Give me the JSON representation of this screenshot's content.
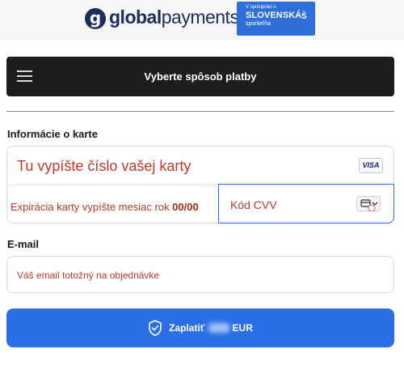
{
  "header": {
    "logo_mark": "g",
    "logo_bold": "global",
    "logo_regular": "payments",
    "partner": {
      "small": "V spolupráci s",
      "big": "SLOVENSKÁ",
      "sub": "sporiteľňa",
      "icon": "Š"
    }
  },
  "topbar": {
    "menu_icon": "hamburger-icon",
    "title": "Vyberte spôsob platby"
  },
  "card_section": {
    "label": "Informácie o karte",
    "number_placeholder": "Tu vypíšte číslo vašej karty",
    "brand": "VISA",
    "expiry_placeholder": "Expirácia karty vypíšte mesiac rok",
    "expiry_format": "00/00",
    "cvv_placeholder": "Kód CVV",
    "cvv_icon": "card-cvv-icon"
  },
  "email_section": {
    "label": "E-mail",
    "placeholder": "Váš email totožný na objednávke"
  },
  "pay": {
    "label": "Zaplatiť",
    "currency": "EUR",
    "icon": "shield-check-icon"
  },
  "colors": {
    "brand_navy": "#1c2e5c",
    "partner_blue": "#2f6fd9",
    "accent_blue": "#2a6fe6",
    "placeholder_red": "#c0392b",
    "topbar_dark": "#1d1d1d"
  }
}
